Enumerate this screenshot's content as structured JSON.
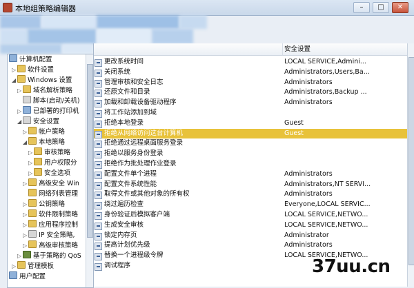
{
  "window": {
    "title": "本地组策略编辑器",
    "controls": {
      "minimize": "–",
      "maximize": "□",
      "close": "✕"
    }
  },
  "tree": {
    "items": [
      {
        "label": "计算机配置",
        "icon": "computer-icon"
      },
      {
        "label": "软件设置",
        "icon": "folder-icon"
      },
      {
        "label": "Windows 设置",
        "icon": "folder-icon"
      },
      {
        "label": "域名解析策略",
        "icon": "folder-icon"
      },
      {
        "label": "脚本(启动/关机)",
        "icon": "document-icon"
      },
      {
        "label": "已部署的打印机",
        "icon": "printer-icon"
      },
      {
        "label": "安全设置",
        "icon": "shield-icon"
      },
      {
        "label": "帐户策略",
        "icon": "folder-icon"
      },
      {
        "label": "本地策略",
        "icon": "folder-icon"
      },
      {
        "label": "审核策略",
        "icon": "folder-icon"
      },
      {
        "label": "用户权限分",
        "icon": "folder-icon"
      },
      {
        "label": "安全选项",
        "icon": "folder-icon"
      },
      {
        "label": "高级安全 Win",
        "icon": "folder-icon"
      },
      {
        "label": "网络列表管理",
        "icon": "folder-icon"
      },
      {
        "label": "公钥策略",
        "icon": "folder-icon"
      },
      {
        "label": "软件限制策略",
        "icon": "folder-icon"
      },
      {
        "label": "应用程序控制",
        "icon": "folder-icon"
      },
      {
        "label": "IP 安全策略,",
        "icon": "lock-icon"
      },
      {
        "label": "高级审核策略",
        "icon": "folder-icon"
      },
      {
        "label": "基于策略的 QoS",
        "icon": "chart-icon"
      },
      {
        "label": "管理模板",
        "icon": "folder-icon"
      },
      {
        "label": "用户配置",
        "icon": "user-icon"
      }
    ]
  },
  "list": {
    "col_policy": "",
    "col_setting": "安全设置",
    "rows": [
      {
        "name": "更改系统时间",
        "value": "LOCAL SERVICE,Admini..."
      },
      {
        "name": "关闭系统",
        "value": "Administrators,Users,Ba..."
      },
      {
        "name": "管理审核和安全日志",
        "value": "Administrators"
      },
      {
        "name": "还原文件和目录",
        "value": "Administrators,Backup ..."
      },
      {
        "name": "加载和卸载设备驱动程序",
        "value": "Administrators"
      },
      {
        "name": "将工作站添加到域",
        "value": ""
      },
      {
        "name": "拒绝本地登录",
        "value": "Guest"
      },
      {
        "name": "拒绝从网络访问这台计算机",
        "value": "Guest",
        "selected": true
      },
      {
        "name": "拒绝通过远程桌面服务登录",
        "value": ""
      },
      {
        "name": "拒绝以服务身份登录",
        "value": ""
      },
      {
        "name": "拒绝作为批处理作业登录",
        "value": ""
      },
      {
        "name": "配置文件单个进程",
        "value": "Administrators"
      },
      {
        "name": "配置文件系统性能",
        "value": "Administrators,NT SERVI..."
      },
      {
        "name": "取得文件或其他对象的所有权",
        "value": "Administrators"
      },
      {
        "name": "绕过遍历检查",
        "value": "Everyone,LOCAL SERVIC..."
      },
      {
        "name": "身份验证后模拟客户端",
        "value": "LOCAL SERVICE,NETWO..."
      },
      {
        "name": "生成安全审核",
        "value": "LOCAL SERVICE,NETWO..."
      },
      {
        "name": "锁定内存页",
        "value": "Administrator"
      },
      {
        "name": "提高计划优先级",
        "value": "Administrators"
      },
      {
        "name": "替换一个进程级令牌",
        "value": "LOCAL SERVICE,NETWO..."
      },
      {
        "name": "调试程序",
        "value": ""
      }
    ]
  },
  "watermark": {
    "text": "37uu.cn"
  },
  "colors": {
    "selection": "#e8c23a",
    "title_bar": "#c9d8ea",
    "pane_border": "#a7b7cb"
  }
}
